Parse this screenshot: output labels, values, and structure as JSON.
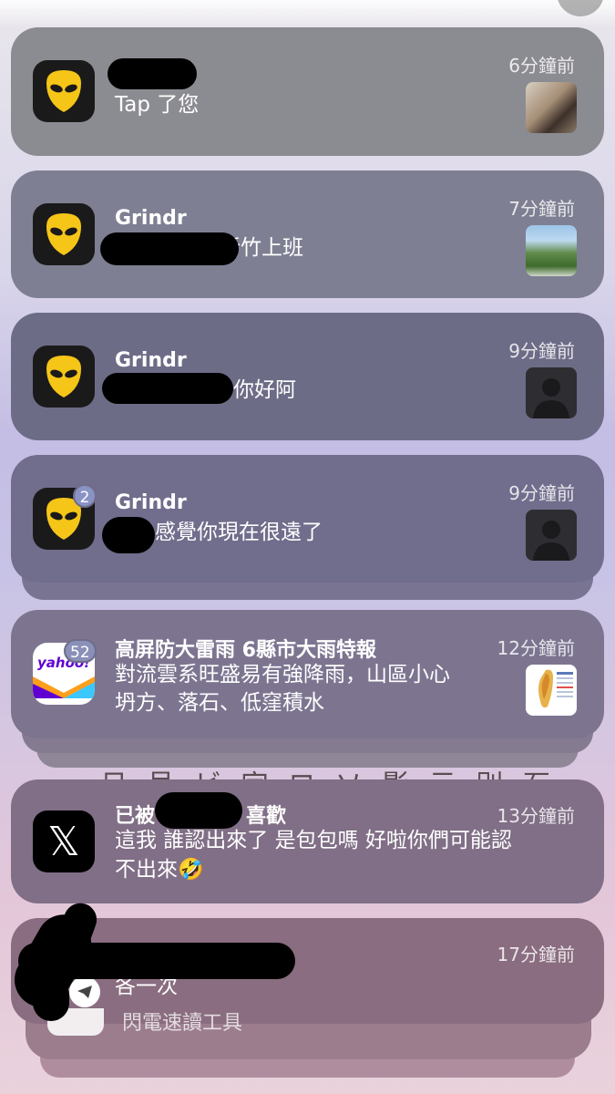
{
  "notifications": [
    {
      "app": "Grindr",
      "title": "",
      "body": "Tap 了您",
      "time": "6分鐘前",
      "badge": ""
    },
    {
      "app": "Grindr",
      "title": "Grindr",
      "body": "我屏東人在新竹上班",
      "time": "7分鐘前",
      "badge": ""
    },
    {
      "app": "Grindr",
      "title": "Grindr",
      "body": "你好阿",
      "time": "9分鐘前",
      "badge": ""
    },
    {
      "app": "Grindr",
      "title": "Grindr",
      "body": "感覺你現在很遠了",
      "time": "9分鐘前",
      "badge": "2"
    },
    {
      "app": "Yahoo",
      "title": "高屏防大雷雨 6縣市大雨特報",
      "body_line1": "對流雲系旺盛易有強降雨，山區小心",
      "body_line2": "坍方、落石、低窪積水",
      "time": "12分鐘前",
      "badge": "52",
      "logo_text": "yahoo!"
    },
    {
      "app": "X",
      "title_prefix": "已被",
      "title_suffix": "喜歡",
      "body_line1": "這我 誰認出來了 是包包嗎 好啦你們可能認",
      "body_line2": "不出來🤣",
      "time": "13分鐘前",
      "logo_text": "𝕏"
    },
    {
      "app": "Telegram",
      "title": "",
      "body": "各一次",
      "time": "17分鐘前",
      "under_text": "閃電速讀工具"
    }
  ],
  "colors": {
    "grindr_yellow": "#f5c518",
    "yahoo_purple": "#6001d2"
  }
}
